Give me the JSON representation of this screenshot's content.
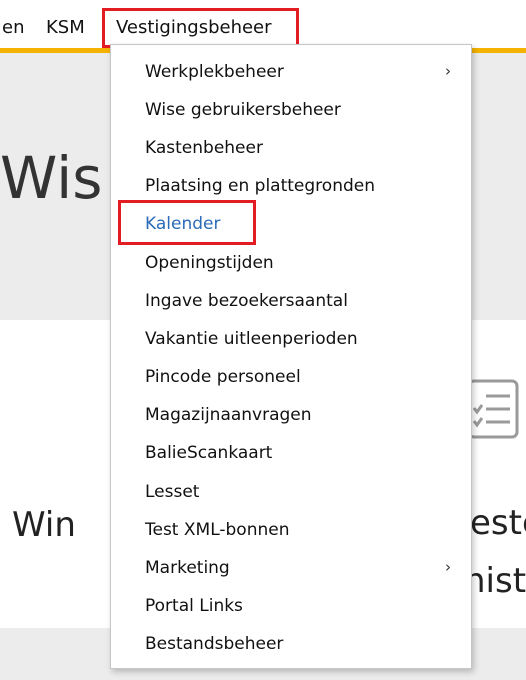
{
  "menubar": {
    "items": [
      {
        "label": "en"
      },
      {
        "label": "KSM"
      },
      {
        "label": "Vestigingsbeheer"
      }
    ]
  },
  "page": {
    "title_partial": "Wis",
    "card_left_partial": "Win",
    "card_right_partial_1": "este",
    "card_right_partial_2": "nist"
  },
  "dropdown": {
    "items": [
      {
        "label": "Werkplekbeheer",
        "has_submenu": true
      },
      {
        "label": "Wise gebruikersbeheer"
      },
      {
        "label": "Kastenbeheer"
      },
      {
        "label": "Plaatsing en plattegronden"
      },
      {
        "label": "Kalender",
        "state": "highlighted"
      },
      {
        "label": "Openingstijden"
      },
      {
        "label": "Ingave bezoekersaantal"
      },
      {
        "label": "Vakantie uitleenperioden"
      },
      {
        "label": "Pincode personeel"
      },
      {
        "label": "Magazijnaanvragen"
      },
      {
        "label": "BalieScankaart"
      },
      {
        "label": "Lesset"
      },
      {
        "label": "Test XML-bonnen"
      },
      {
        "label": "Marketing",
        "has_submenu": true
      },
      {
        "label": "Portal Links"
      },
      {
        "label": "Bestandsbeheer"
      }
    ],
    "submenu_glyph": "›"
  },
  "colors": {
    "annotation": "#e31b23",
    "accent": "#f5b301",
    "link": "#2c6bb8"
  }
}
